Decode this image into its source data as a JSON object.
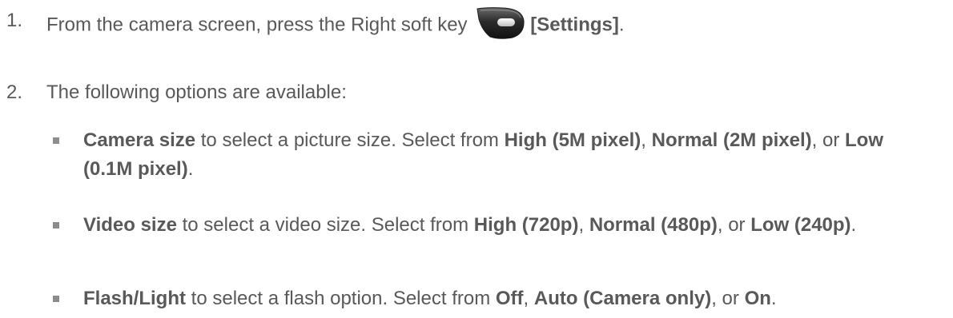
{
  "steps": [
    {
      "number": "1.",
      "text_before": "From the camera screen, press the Right soft key ",
      "icon": "right-soft-key-icon",
      "bold": "[Settings]",
      "text_after": "."
    },
    {
      "number": "2.",
      "text": "The following options are available:"
    }
  ],
  "options": [
    {
      "name": "Camera size",
      "desc": " to select a picture size. Select from ",
      "choice1": "High (5M pixel)",
      "sep1": ", ",
      "choice2": "Normal (2M pixel)",
      "sep2": ", or ",
      "choice3": "Low (0.1M pixel)",
      "end": "."
    },
    {
      "name": "Video size",
      "desc": " to select a video size. Select from ",
      "choice1": "High (720p)",
      "sep1": ", ",
      "choice2": "Normal (480p)",
      "sep2": ", or ",
      "choice3": "Low (240p)",
      "end": "."
    },
    {
      "name": "Flash/Light",
      "desc": " to select a flash option. Select from ",
      "choice1": "Off",
      "sep1": ", ",
      "choice2": "Auto (Camera only)",
      "sep2": ", or ",
      "choice3": "On",
      "end": "."
    }
  ],
  "colors": {
    "text": "#595959",
    "bullet": "#8c8c8c",
    "key_body": "#2b2b2b"
  }
}
